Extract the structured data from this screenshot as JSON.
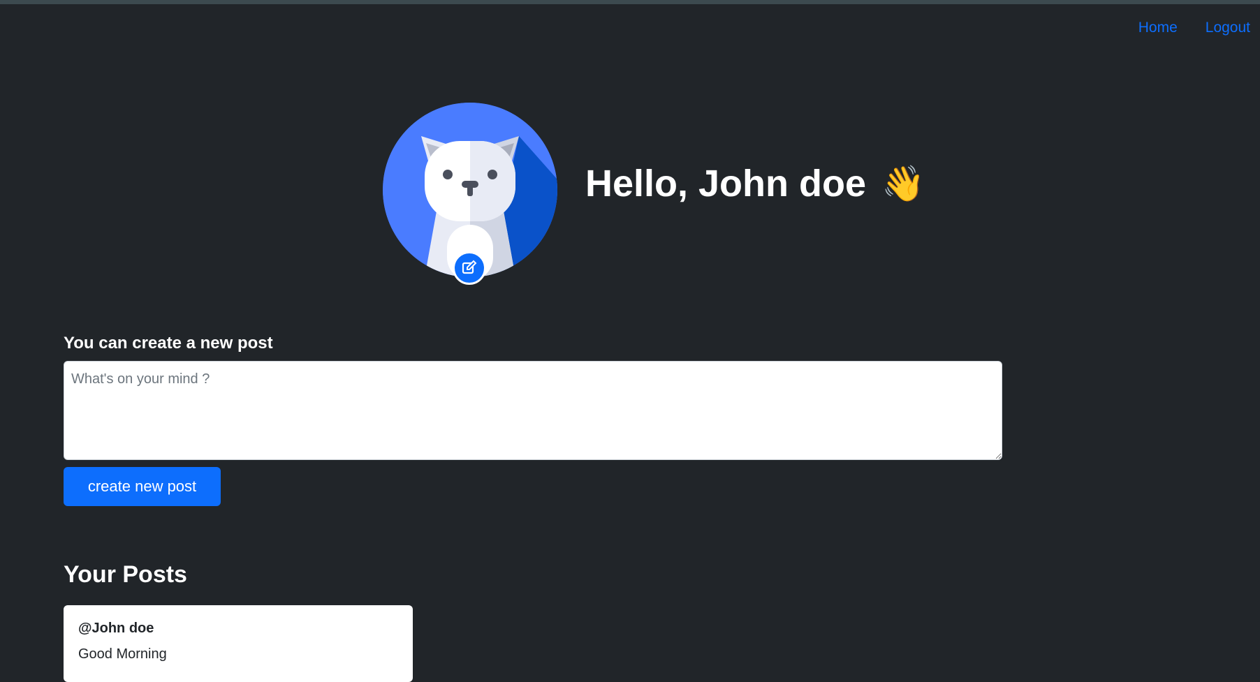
{
  "nav": {
    "home_label": "Home",
    "logout_label": "Logout"
  },
  "profile": {
    "greeting": "Hello, John doe",
    "wave_emoji": "👋"
  },
  "create_post": {
    "label": "You can create a new post",
    "placeholder": "What's on your mind ?",
    "value": "",
    "button_label": "create new post"
  },
  "posts": {
    "title": "Your Posts",
    "items": [
      {
        "author": "@John doe",
        "body": "Good Morning"
      }
    ]
  },
  "colors": {
    "background": "#212529",
    "accent": "#0d6efd",
    "avatar_bg": "#4a7cff"
  },
  "icons": {
    "avatar": "cat-avatar-icon",
    "edit": "edit-icon"
  }
}
